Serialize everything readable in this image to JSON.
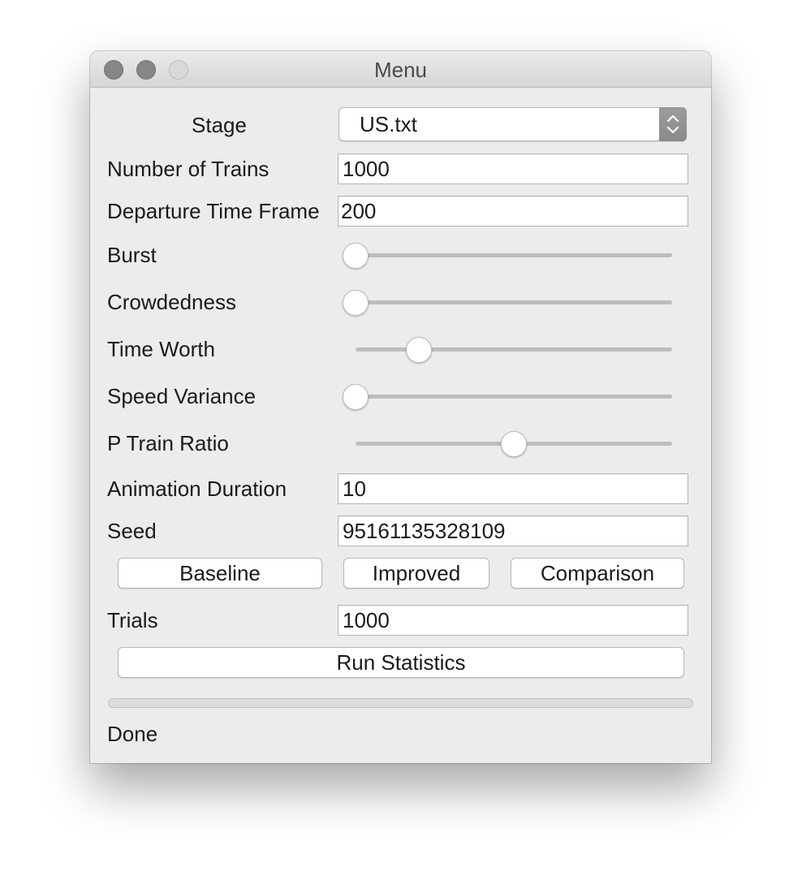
{
  "window": {
    "title": "Menu"
  },
  "form": {
    "stage": {
      "label": "Stage",
      "value": "US.txt"
    },
    "num_trains": {
      "label": "Number of Trains",
      "value": "1000"
    },
    "departure_time_frame": {
      "label": "Departure Time Frame",
      "value": "200"
    },
    "burst": {
      "label": "Burst",
      "level": 0.0
    },
    "crowdedness": {
      "label": "Crowdedness",
      "level": 0.0
    },
    "time_worth": {
      "label": "Time Worth",
      "level": 0.2
    },
    "speed_variance": {
      "label": "Speed Variance",
      "level": 0.0
    },
    "p_train_ratio": {
      "label": "P Train Ratio",
      "level": 0.5
    },
    "animation_duration": {
      "label": "Animation Duration",
      "value": "10"
    },
    "seed": {
      "label": "Seed",
      "value": "95161135328109"
    },
    "trials": {
      "label": "Trials",
      "value": "1000"
    }
  },
  "buttons": {
    "baseline": "Baseline",
    "improved": "Improved",
    "comparison": "Comparison",
    "run_statistics": "Run Statistics"
  },
  "progress": {
    "level": 0.0
  },
  "status": {
    "text": "Done"
  },
  "icons": {
    "close": "close-icon",
    "minimize": "minimize-icon",
    "zoom": "zoom-icon",
    "select_arrows": "chevron-updown-icon"
  }
}
